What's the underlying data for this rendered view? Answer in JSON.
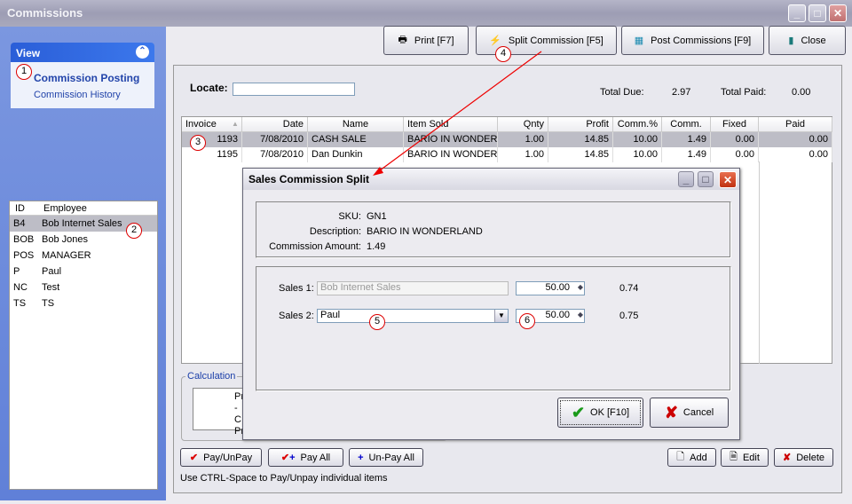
{
  "window": {
    "title": "Commissions"
  },
  "sidebar": {
    "view_title": "View",
    "links": [
      "Commission Posting",
      "Commission History"
    ],
    "employee_headers": [
      "ID",
      "Employee"
    ],
    "employees": [
      [
        "B4",
        "Bob Internet Sales"
      ],
      [
        "BOB",
        "Bob Jones"
      ],
      [
        "POS",
        "MANAGER"
      ],
      [
        "P",
        "Paul"
      ],
      [
        "NC",
        "Test"
      ],
      [
        "TS",
        "TS"
      ]
    ]
  },
  "toolbar": {
    "print": "Print [F7]",
    "split": "Split Commission [F5]",
    "post": "Post Commissions [F9]",
    "close": "Close"
  },
  "main": {
    "locate_label": "Locate:",
    "locate_value": "",
    "total_due_label": "Total Due:",
    "total_due": "2.97",
    "total_paid_label": "Total Paid:",
    "total_paid": "0.00",
    "columns": [
      "Invoice",
      "Date",
      "Name",
      "Item Sold",
      "Qnty",
      "Profit",
      "Comm.%",
      "Comm.",
      "Fixed",
      "Paid"
    ],
    "rows": [
      [
        "1193",
        "7/08/2010",
        "CASH SALE",
        "BARIO IN WONDERI",
        "1.00",
        "14.85",
        "10.00",
        "1.49",
        "0.00",
        "0.00"
      ],
      [
        "1195",
        "7/08/2010",
        "Dan Dunkin",
        "BARIO IN WONDERI",
        "1.00",
        "14.85",
        "10.00",
        "1.49",
        "0.00",
        "0.00"
      ]
    ],
    "calc_label": "Calculation",
    "calc_lines": [
      "Pr",
      "- C",
      "Pr"
    ],
    "pay_unpay": "Pay/UnPay",
    "pay_all": "Pay All",
    "unpay_all": "Un-Pay All",
    "add": "Add",
    "edit": "Edit",
    "delete": "Delete",
    "hint": "Use CTRL-Space to Pay/Unpay individual items"
  },
  "dialog": {
    "title": "Sales Commission Split",
    "sku_label": "SKU:",
    "sku": "GN1",
    "desc_label": "Description:",
    "desc": "BARIO IN WONDERLAND",
    "amount_label": "Commission Amount:",
    "amount": "1.49",
    "sales1_label": "Sales 1:",
    "sales1": "Bob Internet Sales",
    "sales1_pct": "50.00",
    "sales1_amt": "0.74",
    "sales2_label": "Sales 2:",
    "sales2": "Paul",
    "sales2_pct": "50.00",
    "sales2_amt": "0.75",
    "ok": "OK [F10]",
    "cancel": "Cancel"
  },
  "annotations": [
    "1",
    "2",
    "3",
    "4",
    "5",
    "6"
  ],
  "colors": {
    "accent": "#2a5ed8",
    "annotation": "#dd0000",
    "selected_row": "#bdbdc6"
  }
}
